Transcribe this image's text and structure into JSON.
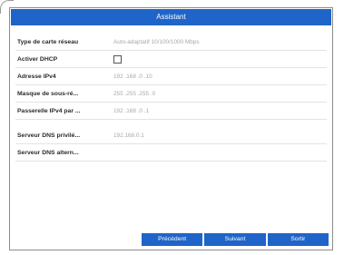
{
  "dialog": {
    "title": "Assistant"
  },
  "fields": {
    "nic_type": {
      "label": "Type de carte réseau",
      "value": "Auto-adaptatif 10/100/1000 Mbps"
    },
    "dhcp": {
      "label": "Activer DHCP",
      "checked": false
    },
    "ipv4": {
      "label": "Adresse IPv4",
      "value": "192 .168 .0    .10"
    },
    "subnet": {
      "label": "Masque de sous-ré...",
      "value": "255 .255 .255 .0"
    },
    "gateway": {
      "label": "Passerelle IPv4 par ...",
      "value": "192 .168 .0    .1"
    },
    "dns_primary": {
      "label": "Serveur DNS privilé...",
      "value": "192.168.0.1"
    },
    "dns_alt": {
      "label": "Serveur DNS altern...",
      "value": ""
    }
  },
  "buttons": {
    "previous": "Précédent",
    "next": "Suivant",
    "exit": "Sortir"
  },
  "colors": {
    "accent": "#1f64c8"
  }
}
